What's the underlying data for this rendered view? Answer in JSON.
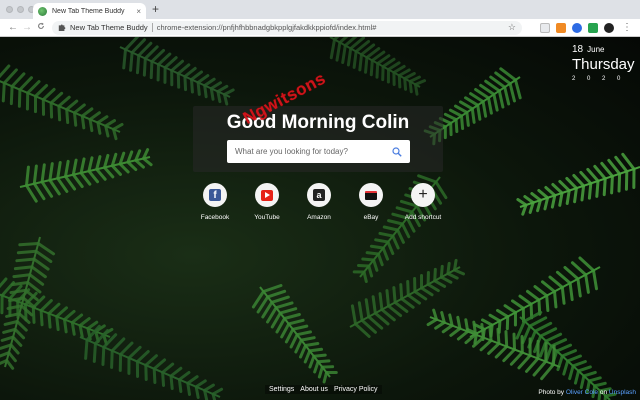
{
  "browser": {
    "tab_title": "New Tab Theme Buddy",
    "tab_close": "×",
    "new_tab": "+",
    "back": "←",
    "forward": "→",
    "reload": "C",
    "omnibox_title": "New Tab Theme Buddy",
    "omnibox_url": "chrome-extension://pnfjhfhbbnadgbkpplgjfakdkkppiofd/index.html#",
    "menu": "⋮"
  },
  "date": {
    "day": "18",
    "month": "June",
    "weekday": "Thursday",
    "year": "2 0 2 0"
  },
  "greeting": "Good Morning Colin",
  "search": {
    "placeholder": "What are you looking for today?"
  },
  "watermark": "Ngwitsons",
  "shortcuts": [
    {
      "label": "Facebook",
      "icon": "facebook-icon"
    },
    {
      "label": "YouTube",
      "icon": "youtube-icon"
    },
    {
      "label": "Amazon",
      "icon": "amazon-icon"
    },
    {
      "label": "eBay",
      "icon": "ebay-icon"
    },
    {
      "label": "Add shortcut",
      "icon": "plus-icon"
    }
  ],
  "icon_glyphs": {
    "facebook": "f",
    "amazon": "a",
    "plus": "+"
  },
  "footer": {
    "settings": "Settings",
    "about": "About us",
    "privacy": "Privacy Policy"
  },
  "credit": {
    "prefix": "Photo by",
    "author": "Oliver Cole",
    "on": "on",
    "site": "Unsplash"
  },
  "colors": {
    "accent_link": "#5aa0ff",
    "youtube_red": "#e62117",
    "facebook_blue": "#3b5998"
  }
}
